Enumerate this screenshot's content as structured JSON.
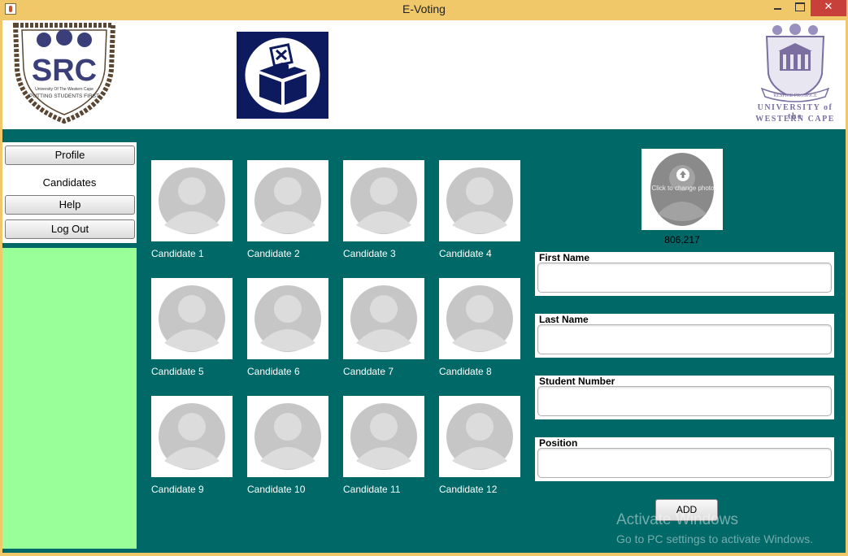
{
  "window": {
    "title": "E-Voting",
    "close_glyph": "✕"
  },
  "header": {
    "src_logo_text": "SRC",
    "src_logo_subtext": "University Of The Western Cape",
    "src_logo_motto": "PUTTING STUDENTS FIRST",
    "uwc_motto": "RESPICE PROSPICE",
    "uwc_name_line1": "UNIVERSITY of the",
    "uwc_name_line2": "WESTERN CAPE",
    "ballot_icon": "ballot-box-icon"
  },
  "sidebar": {
    "profile_label": "Profile",
    "candidates_label": "Candidates",
    "help_label": "Help",
    "logout_label": "Log Out"
  },
  "candidates": [
    "Candidate 1",
    "Candidate 2",
    "Candidate 3",
    "Candidate 4",
    "Candidate 5",
    "Candidate 6",
    "Canddate 7",
    "Candidate 8",
    "Candidate 9",
    "Candidate 10",
    "Candidate 11",
    "Candidate 12"
  ],
  "form": {
    "upload_text": "Click to change photo",
    "photo_coords": "806,217",
    "first_name_label": "First Name",
    "first_name_value": "",
    "last_name_label": "Last Name",
    "last_name_value": "",
    "student_number_label": "Student Number",
    "student_number_value": "",
    "position_label": "Position",
    "position_value": "",
    "add_label": "ADD"
  },
  "watermark": {
    "title": "Activate Windows",
    "subtitle": "Go to PC settings to activate Windows."
  },
  "colors": {
    "main_bg": "#006866",
    "sidebar_green": "#99ff99",
    "titlebar": "#f0c86a",
    "ballot_bg": "#0d1a5e"
  }
}
